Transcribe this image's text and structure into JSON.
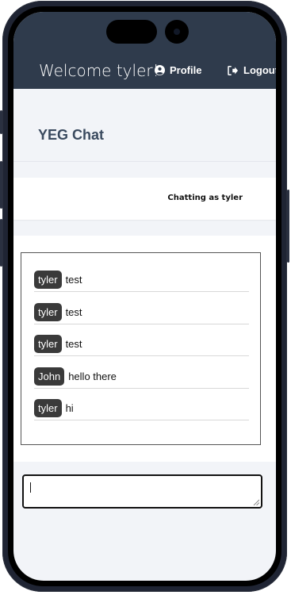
{
  "navbar": {
    "welcome": "Welcome tyler!",
    "profile_label": "Profile",
    "logout_label": "Logout",
    "profile_icon": "user-circle-icon",
    "logout_icon": "sign-out-icon"
  },
  "page": {
    "title": "YEG Chat",
    "status": "Chatting as tyler"
  },
  "messages": [
    {
      "user": "tyler",
      "text": "test"
    },
    {
      "user": "tyler",
      "text": "test"
    },
    {
      "user": "tyler",
      "text": "test"
    },
    {
      "user": "John",
      "text": "hello there"
    },
    {
      "user": "tyler",
      "text": "hi"
    }
  ],
  "composer": {
    "value": "",
    "placeholder": ""
  },
  "colors": {
    "navbar": "#2f3b4c",
    "title": "#3a4a5f",
    "badge": "#3a3a3a"
  }
}
